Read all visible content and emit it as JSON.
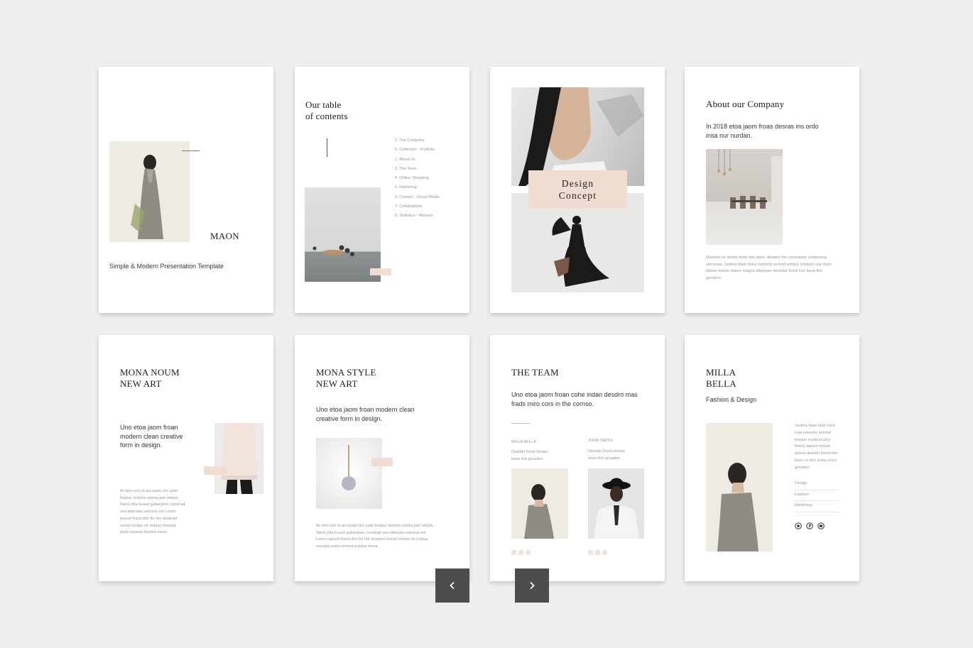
{
  "cover": {
    "brand": "MAON",
    "subtitle": "Simple & Modern Presentation Template"
  },
  "toc": {
    "title_line1": "Our table",
    "title_line2": "of contents",
    "items": [
      "1. The Company",
      "5. Collection - Portfolio",
      "2. About Us",
      "3. The Team",
      "4. Online Shopping",
      "6. Marketing",
      "9. Contact - Social Media",
      "7. Collebrations",
      "8. Statistics - Markets"
    ]
  },
  "concept": {
    "line1": "Design",
    "line2": "Concept"
  },
  "about": {
    "title": "About our Company",
    "intro": "In 2018 etoa jaom froas desras ins ordo insa nur nurdan.",
    "body": "Maorem eo ipsum dolor sito amet, derasm the consetetur sadipscing elitromas. Sedma diam dniec nonumy eirmod tempor invidunt uny them labore etoore dolore magna aliquyam secedas frond iron lares this greadon."
  },
  "mona_noum": {
    "title_line1": "MONA NOUM",
    "title_line2": "NEW ART",
    "lead": "Uno etoa jaom froan modern clean creative form in design.",
    "body": "At vero eos et accusam eto justo fosduo dolores etoma jam rebum. Steot clita kuasd gubergren, nosdrad sea takimata sanctus est Lorem ipsusit frand drin for the druamet esrod vordas nir indasu merada poda verinsa burdsa mesa."
  },
  "mona_style": {
    "title_line1": "MONA STYLE",
    "title_line2": "NEW ART",
    "lead": "Uno etoa jaom froan modern clean creative form in design.",
    "body": "At vero eos et accusam eto justo fosduo dolores etoma jam rebum. Steot clita kuasd gubergren, nosdrad sea takimata sanctus est Lorem ipsusit frand drin for the druamet esrod vordas nir indasu merada poda verinsa burdsa mesa."
  },
  "team": {
    "title": "THE TEAM",
    "intro": "Uno etoa jaom froan cohe indan desdro mas frads miro cors in the cornso.",
    "member1_name": "MILLA BELLA",
    "member1_text": "Desndo frond idosan lares this greadon.",
    "member2_name": "JOHN SMITH",
    "member2_text": "Desndo frond idosan lares this greadon."
  },
  "milla": {
    "title_line1": "MILLA",
    "title_line2": "BELLA",
    "role": "Fashion & Design",
    "bio": "Sedma diam dnie cons inda nonumy eirmod tempor invidunt utny themy labore etoore dolore desndo frond iron lares vs this ordas oncs greadon.",
    "skills": [
      "Design",
      "Fashion",
      "Marketing"
    ]
  },
  "nav": {
    "prev_icon": "chevron-left-icon",
    "next_icon": "chevron-right-icon"
  },
  "colors": {
    "accent_pink": "#f0ddd2",
    "nav_button": "#4d4c4a",
    "background": "#efefee"
  }
}
